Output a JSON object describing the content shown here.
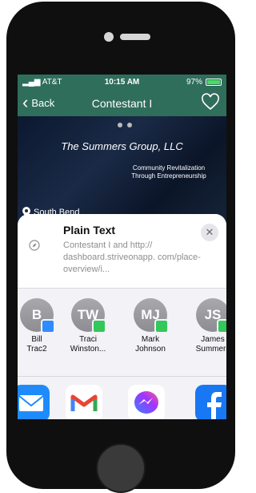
{
  "status": {
    "carrier": "AT&T",
    "time": "10:15 AM",
    "battery": "97%"
  },
  "nav": {
    "back_label": "Back",
    "title": "Contestant I"
  },
  "hero": {
    "company": "The Summers Group, LLC",
    "tagline": "Community Revitalization Through Entrepreneurship",
    "location": "South Bend"
  },
  "share": {
    "title": "Plain Text",
    "body": "Contestant I and http:// dashboard.striveonapp. com/place-overview/i...",
    "contacts": [
      {
        "initials": "B",
        "line1": "Bill",
        "line2": "Trac2",
        "badge": "airdrop"
      },
      {
        "initials": "TW",
        "line1": "Traci",
        "line2": "Winston...",
        "badge": "message"
      },
      {
        "initials": "MJ",
        "line1": "Mark",
        "line2": "Johnson",
        "badge": "message"
      },
      {
        "initials": "JS",
        "line1": "James",
        "line2": "Summers",
        "badge": "message"
      }
    ],
    "apps": [
      "mail",
      "gmail",
      "messenger",
      "facebook"
    ]
  }
}
